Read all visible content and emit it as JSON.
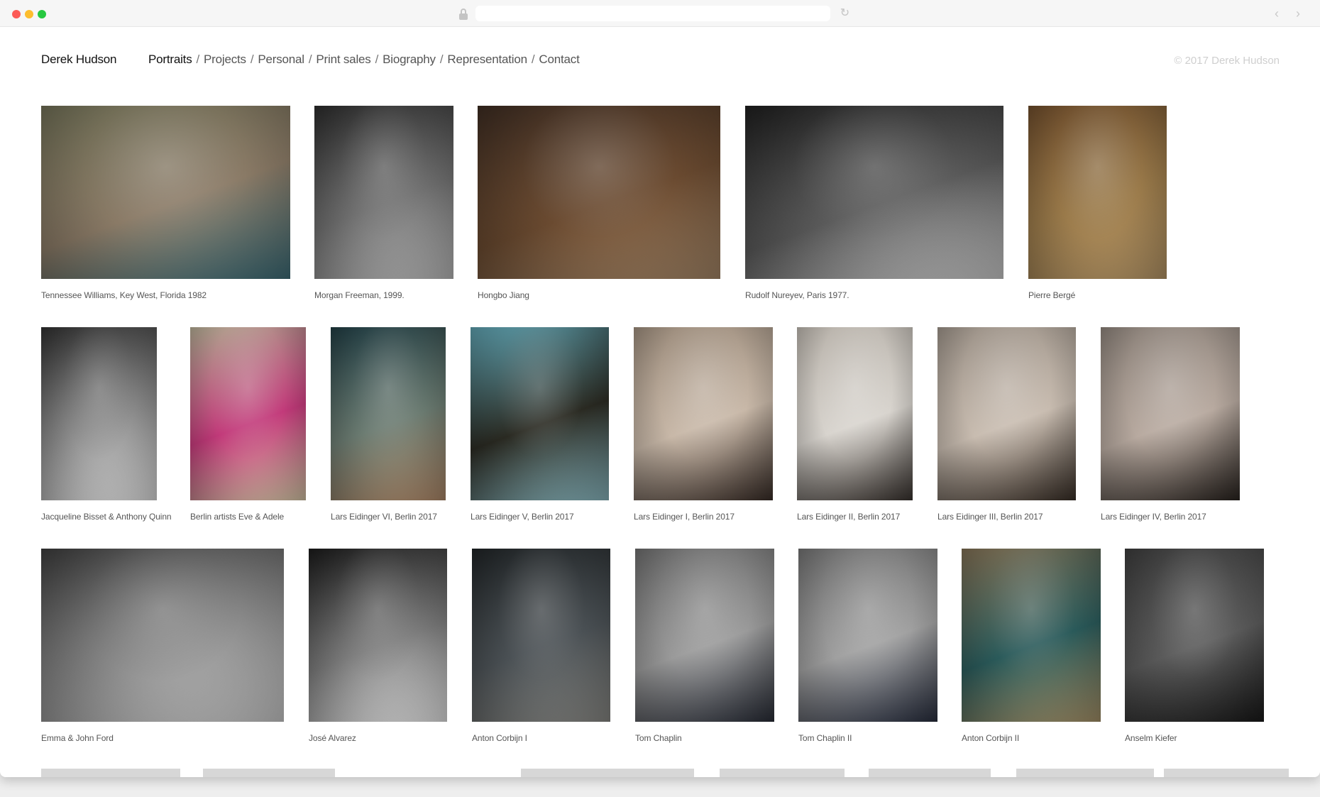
{
  "browser": {
    "url": "",
    "reload_icon": "reload-icon",
    "back_icon": "chevron-left-icon",
    "forward_icon": "chevron-right-icon",
    "reload_glyph": "↻",
    "back_glyph": "‹",
    "forward_glyph": "›"
  },
  "site": {
    "title": "Derek Hudson",
    "copyright": "© 2017 Derek Hudson"
  },
  "nav": {
    "separator": "/",
    "items": [
      {
        "label": "Portraits",
        "active": true
      },
      {
        "label": "Projects",
        "active": false
      },
      {
        "label": "Personal",
        "active": false
      },
      {
        "label": "Print sales",
        "active": false
      },
      {
        "label": "Biography",
        "active": false
      },
      {
        "label": "Representation",
        "active": false
      },
      {
        "label": "Contact",
        "active": false
      }
    ]
  },
  "gallery": {
    "rows": [
      [
        {
          "caption": "Tennessee Williams, Key West, Florida 1982",
          "tone": [
            "#6b6a52",
            "#8a7a66",
            "#3f6f7a"
          ]
        },
        {
          "caption": "Morgan Freeman, 1999.",
          "tone": [
            "#2a2a2a",
            "#6e6e6e",
            "#bdbdbd"
          ]
        },
        {
          "caption": "Hongbo Jiang",
          "tone": [
            "#3a2a20",
            "#6a4a30",
            "#a98a6a"
          ]
        },
        {
          "caption": "Rudolf Nureyev, Paris 1977.",
          "tone": [
            "#1e1e1e",
            "#5a5a5a",
            "#d0d0d0"
          ]
        },
        {
          "caption": "Pierre Bergé",
          "tone": [
            "#6a4a2a",
            "#9a7a4a",
            "#b89868"
          ]
        }
      ],
      [
        {
          "caption": "Jacqueline Bisset & Anthony Quinn",
          "tone": [
            "#2e2e2e",
            "#8a8a8a",
            "#e0e0e0"
          ]
        },
        {
          "caption": "Berlin artists Eve & Adele",
          "tone": [
            "#b0a890",
            "#c23a7a",
            "#d8c8a8"
          ]
        },
        {
          "caption": "Lars Eidinger VI, Berlin 2017",
          "tone": [
            "#1f3a40",
            "#6a7a70",
            "#b08a6a"
          ]
        },
        {
          "caption": "Lars Eidinger V, Berlin 2017",
          "tone": [
            "#5a9aa8",
            "#2a2a22",
            "#8ab8c0"
          ]
        },
        {
          "caption": "Lars Eidinger I, Berlin 2017",
          "tone": [
            "#9a8a7a",
            "#c8b8a8",
            "#3a2e28"
          ]
        },
        {
          "caption": "Lars Eidinger II, Berlin 2017",
          "tone": [
            "#b8b2aa",
            "#d8d4ce",
            "#3a3430"
          ]
        },
        {
          "caption": "Lars Eidinger III, Berlin 2017",
          "tone": [
            "#9a9086",
            "#c8bcb0",
            "#3a3028"
          ]
        },
        {
          "caption": "Lars Eidinger IV, Berlin 2017",
          "tone": [
            "#8a8078",
            "#b8aaa0",
            "#2a2420"
          ]
        }
      ],
      [
        {
          "caption": "Emma & John Ford",
          "tone": [
            "#3a3a3a",
            "#8a8a8a",
            "#cfcfcf"
          ]
        },
        {
          "caption": "José Alvarez",
          "tone": [
            "#1a1a1a",
            "#7a7a7a",
            "#e8e8e8"
          ]
        },
        {
          "caption": "Anton Corbijn I",
          "tone": [
            "#1e2224",
            "#4a5054",
            "#8a8a86"
          ]
        },
        {
          "caption": "Tom Chaplin",
          "tone": [
            "#6a6a6a",
            "#9a9a9a",
            "#2a2e38"
          ]
        },
        {
          "caption": "Tom Chaplin II",
          "tone": [
            "#6e6e6e",
            "#a0a0a0",
            "#2a3040"
          ]
        },
        {
          "caption": "Anton Corbijn II",
          "tone": [
            "#7a6a50",
            "#2a5a5a",
            "#a8946a"
          ]
        },
        {
          "caption": "Anselm Kiefer",
          "tone": [
            "#3a3a3a",
            "#5a5a5a",
            "#1a1a1a"
          ]
        }
      ]
    ]
  }
}
